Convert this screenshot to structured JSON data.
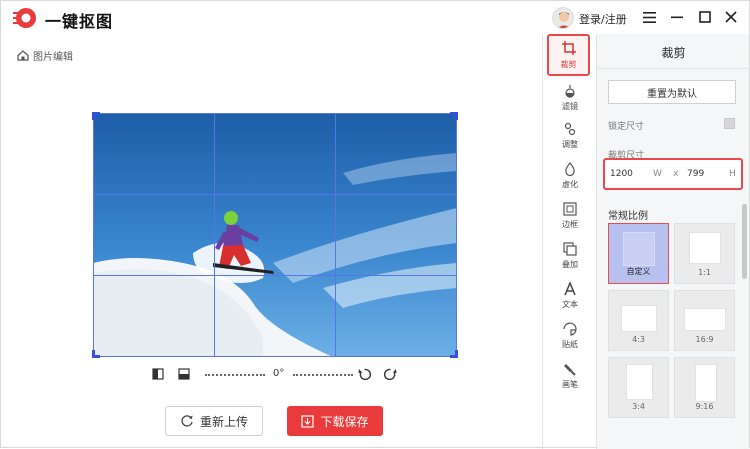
{
  "app": {
    "name": "一键抠图",
    "login": "登录/注册",
    "accent": "#e93b3b"
  },
  "breadcrumb": {
    "label": "图片编辑"
  },
  "editor": {
    "rotation": "0°",
    "reupload_label": "重新上传",
    "download_label": "下载保存"
  },
  "toolbar": {
    "items": [
      {
        "label": "裁剪",
        "icon": "crop-icon",
        "active": true
      },
      {
        "label": "滤镜",
        "icon": "filter-icon"
      },
      {
        "label": "调整",
        "icon": "adjust-icon"
      },
      {
        "label": "虚化",
        "icon": "blur-icon"
      },
      {
        "label": "边框",
        "icon": "border-icon"
      },
      {
        "label": "叠加",
        "icon": "overlay-icon"
      },
      {
        "label": "文本",
        "icon": "text-icon"
      },
      {
        "label": "贴纸",
        "icon": "sticker-icon"
      },
      {
        "label": "画笔",
        "icon": "brush-icon"
      }
    ]
  },
  "panel": {
    "title": "裁剪",
    "reset_label": "重置为默认",
    "lock_label": "锁定尺寸",
    "size_label": "裁剪尺寸",
    "width": "1200",
    "width_unit": "W",
    "times": "x",
    "height": "799",
    "height_unit": "H",
    "ratio_title": "常规比例",
    "ratios": [
      {
        "label": "自定义",
        "selected": true
      },
      {
        "label": "1:1"
      },
      {
        "label": "4:3"
      },
      {
        "label": "16:9"
      },
      {
        "label": "3:4"
      },
      {
        "label": "9:16"
      }
    ]
  }
}
